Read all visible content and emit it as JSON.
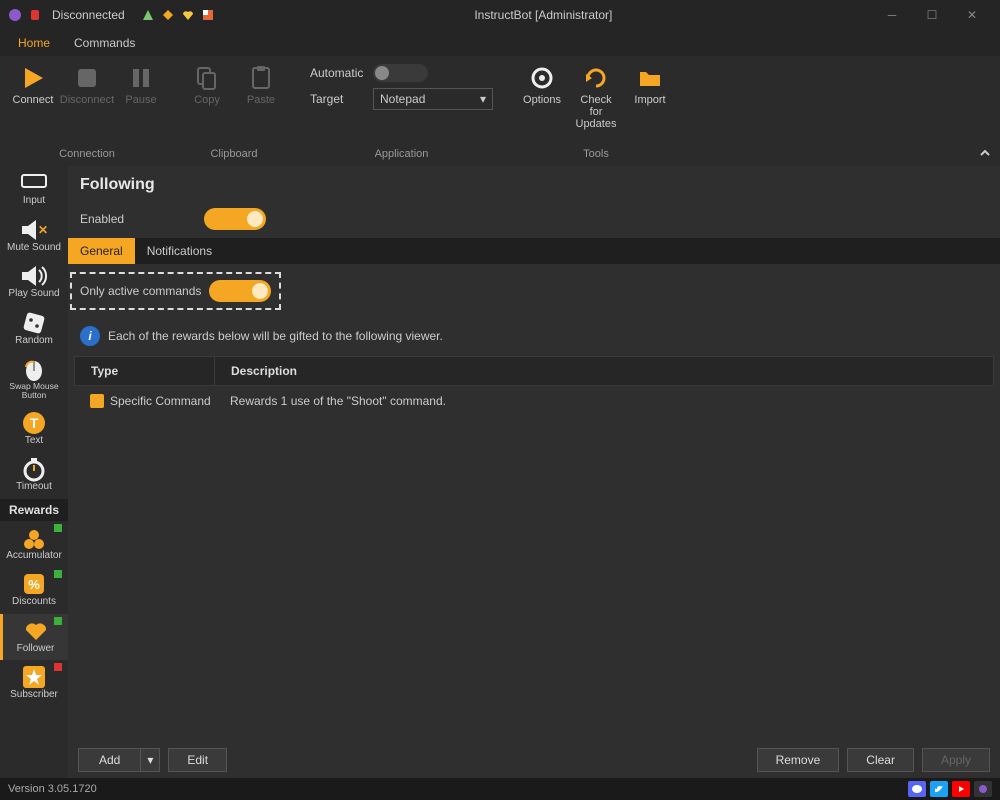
{
  "titlebar": {
    "status": "Disconnected",
    "title": "InstructBot [Administrator]"
  },
  "menubar": {
    "home": "Home",
    "commands": "Commands"
  },
  "ribbon": {
    "connect": "Connect",
    "disconnect": "Disconnect",
    "pause": "Pause",
    "connection_group": "Connection",
    "copy": "Copy",
    "paste": "Paste",
    "clipboard_group": "Clipboard",
    "automatic_label": "Automatic",
    "target_label": "Target",
    "target_value": "Notepad",
    "application_group": "Application",
    "options": "Options",
    "check_updates": "Check for Updates",
    "import": "Import",
    "tools_group": "Tools"
  },
  "sidebar": {
    "input": "Input",
    "mute_sound": "Mute Sound",
    "play_sound": "Play Sound",
    "random": "Random",
    "swap_mouse": "Swap Mouse Button",
    "text": "Text",
    "timeout": "Timeout",
    "rewards_heading": "Rewards",
    "accumulator": "Accumulator",
    "discounts": "Discounts",
    "follower": "Follower",
    "subscriber": "Subscriber"
  },
  "content": {
    "heading": "Following",
    "enabled_label": "Enabled",
    "tab_general": "General",
    "tab_notifications": "Notifications",
    "only_active": "Only active commands",
    "info_text": "Each of the rewards below will be gifted to the following viewer.",
    "col_type": "Type",
    "col_desc": "Description",
    "row_type": "Specific Command",
    "row_desc": "Rewards 1 use of the \"Shoot\" command."
  },
  "actions": {
    "add": "Add",
    "edit": "Edit",
    "remove": "Remove",
    "clear": "Clear",
    "apply": "Apply"
  },
  "statusbar": {
    "version": "Version 3.05.1720"
  }
}
